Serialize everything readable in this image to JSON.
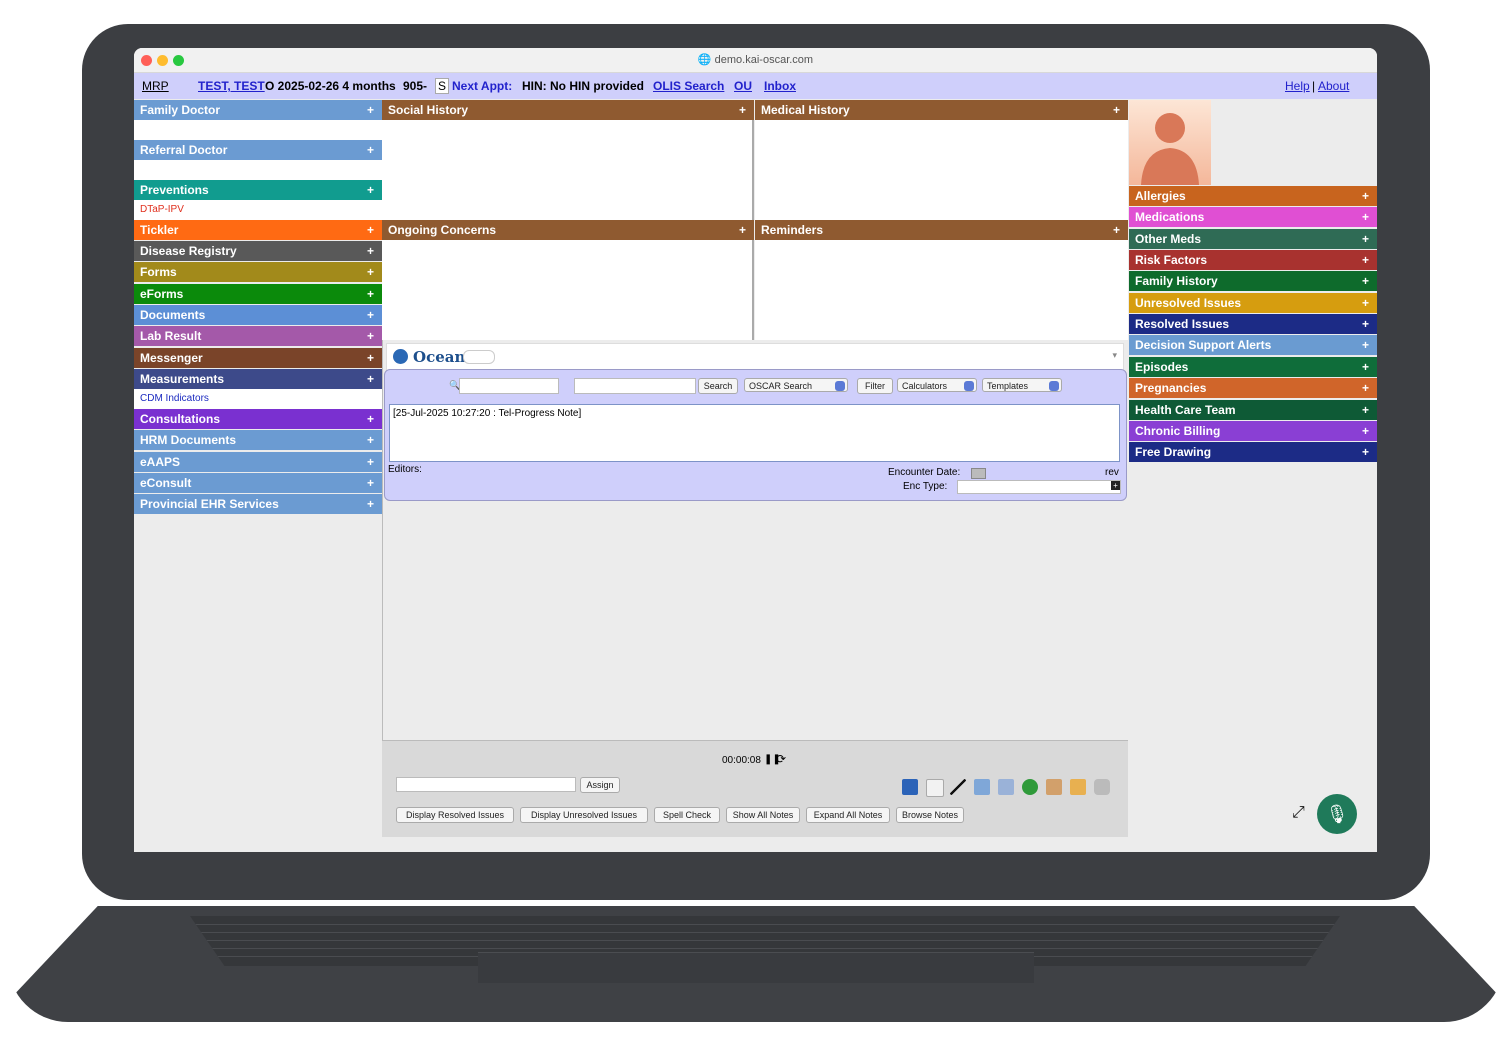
{
  "browser": {
    "url": "demo.kai-oscar.com"
  },
  "topbar": {
    "mrp": "MRP",
    "patient_name": "TEST, TEST",
    "patient_info": "O 2025-02-26 4 months",
    "phone": "905-",
    "s_label": "S",
    "next_appt": "Next Appt:",
    "hin": "HIN: No HIN provided",
    "olis": "OLIS Search",
    "ou": "OU",
    "inbox": "Inbox",
    "help": "Help",
    "separator": "|",
    "about": "About"
  },
  "left_sidebar": {
    "items": [
      {
        "label": "Family Doctor",
        "color": "#6b9bd2"
      },
      {
        "label": "Referral Doctor",
        "color": "#6b9bd2"
      },
      {
        "label": "Preventions",
        "color": "#119c8f"
      },
      {
        "label": "Tickler",
        "color": "#ff6a13"
      },
      {
        "label": "Disease Registry",
        "color": "#595959"
      },
      {
        "label": "Forms",
        "color": "#a28a1b"
      },
      {
        "label": "eForms",
        "color": "#0b8a0b"
      },
      {
        "label": "Documents",
        "color": "#5c8fd6"
      },
      {
        "label": "Lab Result",
        "color": "#a459a9"
      },
      {
        "label": "Messenger",
        "color": "#7a4429"
      },
      {
        "label": "Measurements",
        "color": "#3d4a8a"
      },
      {
        "label": "Consultations",
        "color": "#7a30d0"
      },
      {
        "label": "HRM Documents",
        "color": "#6b9bd2"
      },
      {
        "label": "eAAPS",
        "color": "#6b9bd2"
      },
      {
        "label": "eConsult",
        "color": "#6b9bd2"
      },
      {
        "label": "Provincial EHR Services",
        "color": "#6b9bd2"
      }
    ],
    "preventions_sub": "DTaP-IPV",
    "measurements_sub": "CDM Indicators",
    "plus": "+"
  },
  "center": {
    "social_history": "Social History",
    "medical_history": "Medical History",
    "ongoing_concerns": "Ongoing Concerns",
    "reminders": "Reminders",
    "ocean": "Ocean",
    "search_btn": "Search",
    "oscar_search": "OSCAR Search",
    "filter_btn": "Filter",
    "calculators": "Calculators",
    "templates": "Templates",
    "note_text": "[25-Jul-2025 10:27:20 : Tel-Progress Note]",
    "editors_label": "Editors:",
    "encounter_date_label": "Encounter Date:",
    "rev_label": "rev",
    "enc_type_label": "Enc Type:",
    "timer": "00:00:08",
    "assign_btn": "Assign",
    "bottom_buttons": [
      "Display Resolved Issues",
      "Display Unresolved Issues",
      "Spell Check",
      "Show All Notes",
      "Expand All Notes",
      "Browse Notes"
    ]
  },
  "right_sidebar": {
    "items": [
      {
        "label": "Allergies",
        "color": "#c8641e"
      },
      {
        "label": "Medications",
        "color": "#e04fd3"
      },
      {
        "label": "Other Meds",
        "color": "#2f6b55"
      },
      {
        "label": "Risk Factors",
        "color": "#a8322f"
      },
      {
        "label": "Family History",
        "color": "#0e6b2c"
      },
      {
        "label": "Unresolved Issues",
        "color": "#d69d0f"
      },
      {
        "label": "Resolved Issues",
        "color": "#1c2b86"
      },
      {
        "label": "Decision Support Alerts",
        "color": "#6a9bd1"
      },
      {
        "label": "Episodes",
        "color": "#0f6d3a"
      },
      {
        "label": "Pregnancies",
        "color": "#d0652a"
      },
      {
        "label": "Health Care Team",
        "color": "#0e5a36"
      },
      {
        "label": "Chronic Billing",
        "color": "#8a3fd4"
      },
      {
        "label": "Free Drawing",
        "color": "#1c2b86"
      }
    ],
    "plus": "+"
  }
}
